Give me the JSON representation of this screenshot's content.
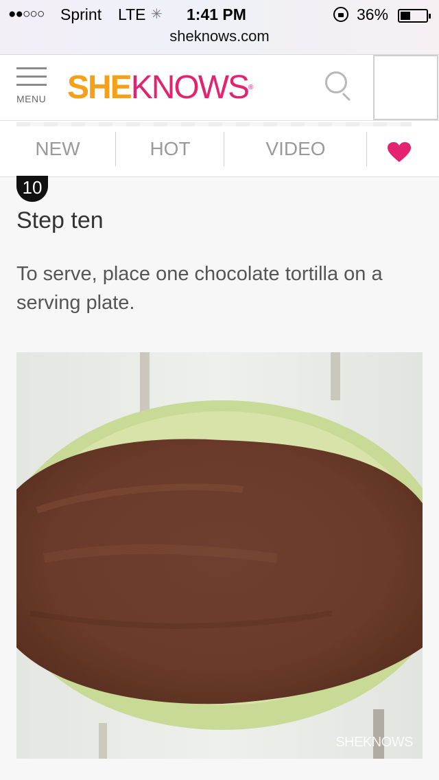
{
  "status_bar": {
    "signal": "●●○○○",
    "carrier": "Sprint",
    "network": "LTE",
    "time": "1:41 PM",
    "battery": "36%"
  },
  "browser": {
    "url": "sheknows.com"
  },
  "header": {
    "menu_label": "MENU",
    "logo_she": "SHE",
    "logo_knows": "KNOWS",
    "logo_reg": "®"
  },
  "tabs": [
    {
      "label": "NEW"
    },
    {
      "label": "HOT"
    },
    {
      "label": "VIDEO"
    }
  ],
  "colors": {
    "brand_orange": "#f6a01a",
    "brand_pink": "#e3236f",
    "heart": "#e3236f"
  },
  "step": {
    "number": "10",
    "title": "Step ten",
    "text": "To serve, place one chocolate tortilla on a serving plate."
  },
  "photo": {
    "watermark": "SHEKNOWS",
    "description_icon": "chocolate-tortilla-photo"
  }
}
